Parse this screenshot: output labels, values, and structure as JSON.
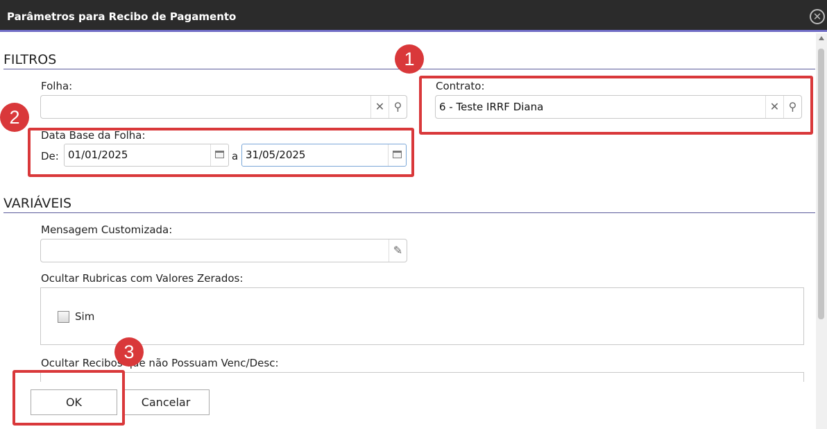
{
  "dialog": {
    "title": "Parâmetros para Recibo de Pagamento",
    "close_icon": "close-circle-icon"
  },
  "filters": {
    "section_title": "FILTROS",
    "folha": {
      "label": "Folha:",
      "value": "",
      "clear_icon": "clear-x-icon",
      "search_icon": "search-icon"
    },
    "contrato": {
      "label": "Contrato:",
      "value": "6 - Teste IRRF Diana",
      "clear_icon": "clear-x-icon",
      "search_icon": "search-icon"
    },
    "data_base": {
      "label": "Data Base da Folha:",
      "from_label": "De:",
      "from_value": "01/01/2025",
      "to_label": "a",
      "to_value": "31/05/2025",
      "calendar_icon": "calendar-icon"
    }
  },
  "variables": {
    "section_title": "VARIÁVEIS",
    "mensagem": {
      "label": "Mensagem Customizada:",
      "value": "",
      "edit_icon": "pencil-icon"
    },
    "ocultar_rubricas": {
      "label": "Ocultar Rubricas com Valores Zerados:",
      "option_label": "Sim",
      "checked": false
    },
    "ocultar_recibos": {
      "label": "Ocultar Recibos que não Possuam Venc/Desc:"
    }
  },
  "footer": {
    "ok_label": "OK",
    "cancel_label": "Cancelar"
  },
  "annotations": {
    "color": "#d9383a",
    "labels": [
      "1",
      "2",
      "3"
    ]
  },
  "colors": {
    "titlebar": "#2b2b2b",
    "accent": "#6f6cc4"
  }
}
